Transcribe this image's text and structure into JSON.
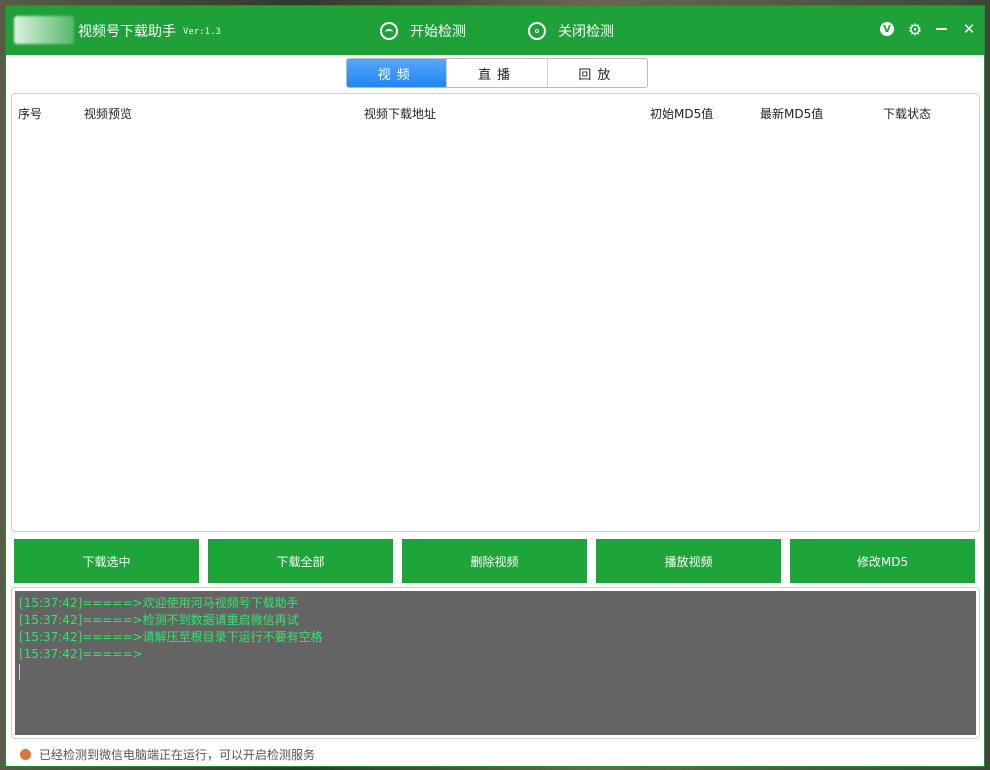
{
  "app": {
    "title": "视频号下载助手",
    "version": "Ver:1.3"
  },
  "toolbar": {
    "start_label": "开始检测",
    "stop_label": "关闭检测",
    "v_badge": "V"
  },
  "tabs": [
    {
      "label": "视频",
      "active": true
    },
    {
      "label": "直播",
      "active": false
    },
    {
      "label": "回放",
      "active": false
    }
  ],
  "table": {
    "columns": [
      "序号",
      "视频预览",
      "视频下载地址",
      "初始MD5值",
      "最新MD5值",
      "下载状态"
    ],
    "rows": []
  },
  "actions": [
    "下载选中",
    "下载全部",
    "删除视频",
    "播放视频",
    "修改MD5"
  ],
  "log": [
    "[15:37:42]=====>欢迎使用河马视频号下载助手",
    "[15:37:42]=====>检测不到数据请重启微信再试",
    "[15:37:42]=====>请解压至根目录下运行不要有空格",
    "[15:37:42]=====>"
  ],
  "status": {
    "text": "已经检测到微信电脑端正在运行，可以开启检测服务",
    "dot_color": "#d9773a"
  },
  "colors": {
    "brand_green": "#1fa13a",
    "tab_active_blue": "#1e86f0",
    "log_bg": "#646464",
    "log_text": "#2ee86a"
  }
}
